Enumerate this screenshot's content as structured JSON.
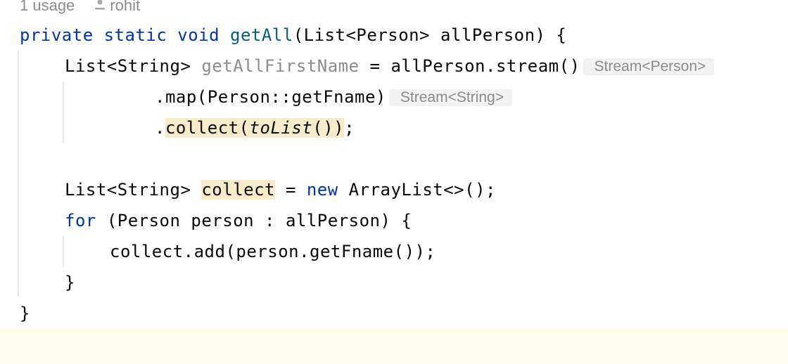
{
  "hints": {
    "usages": "1 usage",
    "author": "rohit"
  },
  "colors": {
    "keyword": "#0033b3",
    "method_declaration": "#00627a",
    "unused": "#8c8c8c",
    "highlight": "#f5ebc8",
    "inlay_background": "#f2f2f2"
  },
  "code": {
    "l1": {
      "kw": "private static void",
      "name": "getAll",
      "rest": "(List<Person> allPerson) {"
    },
    "l2": {
      "type": "List<String>",
      "var": "getAllFirstName",
      "rest": "= allPerson.stream()",
      "inlay": "Stream<Person>"
    },
    "l3": {
      "code": ".map(Person::getFname)",
      "inlay": "Stream<String>"
    },
    "l4": {
      "dot": ".",
      "call": "collect(",
      "static_call": "toList",
      "close": "())",
      "semi": ";"
    },
    "l6": {
      "type": "List<String>",
      "var": "collect",
      "eq": "=",
      "kw": "new",
      "rest": "ArrayList<>();"
    },
    "l7": {
      "kw": "for",
      "rest": "(Person person : allPerson) {"
    },
    "l8": {
      "code": "collect.add(person.getFname());"
    },
    "l9": {
      "code": "}"
    },
    "l10": {
      "code": "}"
    }
  }
}
